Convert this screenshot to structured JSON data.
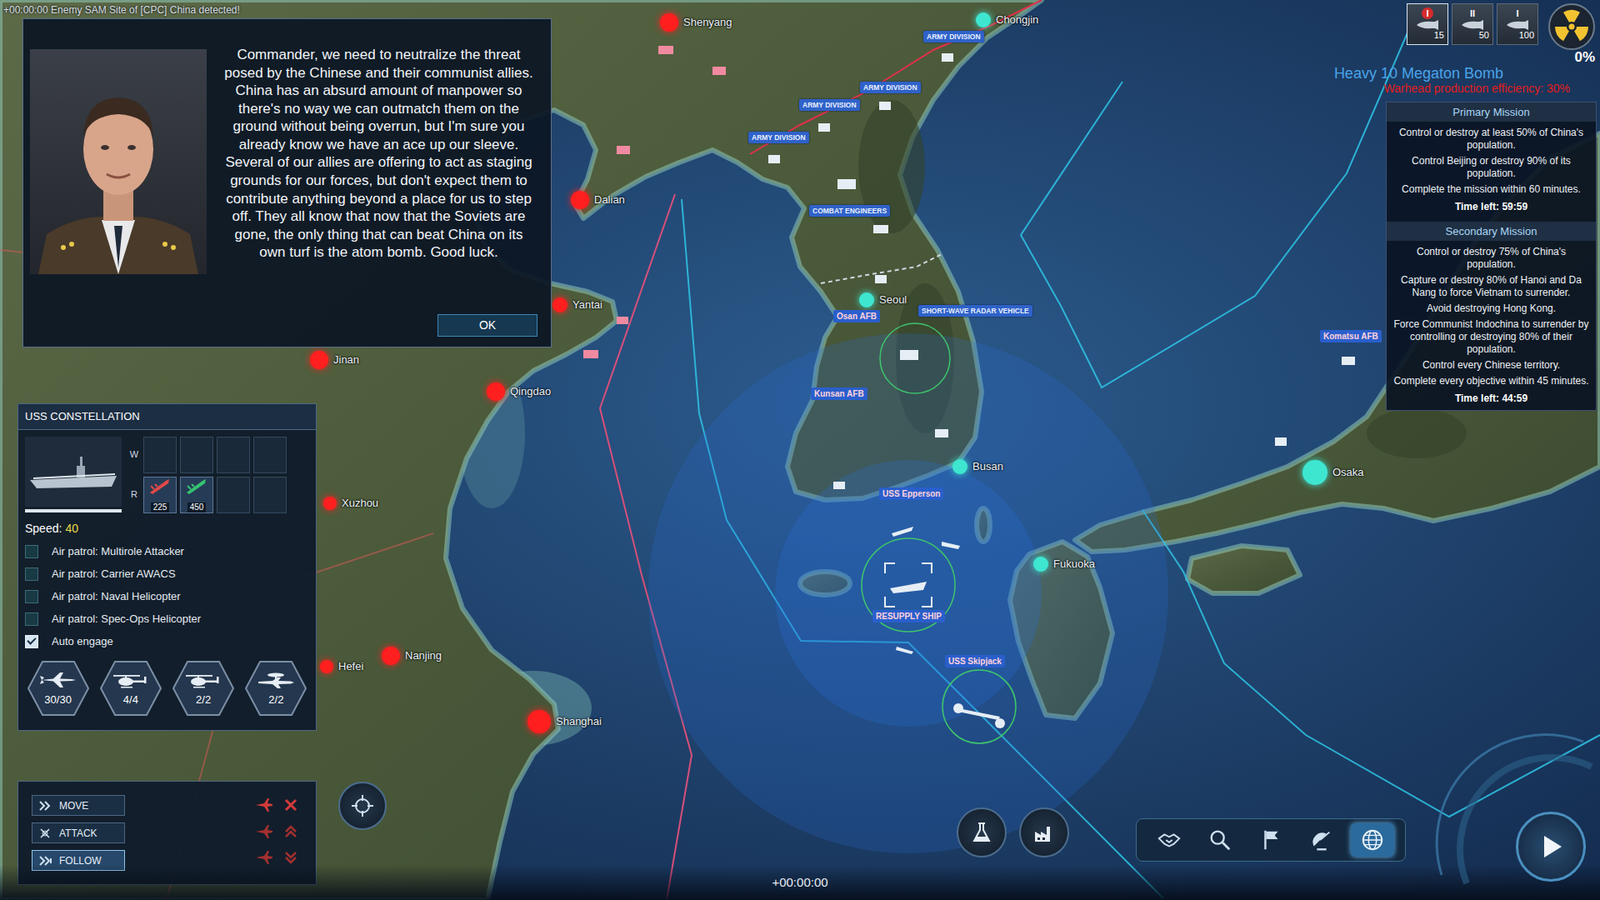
{
  "event_log": "+00:00:00 Enemy SAM Site of [CPC] China detected!",
  "dialog": {
    "message": "Commander, we need to neutralize the threat posed by the Chinese and their communist allies. China has an absurd amount of manpower so there's no way we can outmatch them on the ground without being overrun, but I'm sure you already know we have an ace up our sleeve. Several of our allies are offering to act as staging grounds for our forces, but don't expect them to contribute anything beyond a place for us to step off. They all know that now that the Soviets are gone, the only thing that can beat China on its own turf is the atom bomb. Good luck.",
    "button": "OK"
  },
  "map": {
    "cities": [
      {
        "name": "Shenyang",
        "color": "#ff1f1f"
      },
      {
        "name": "Chongjin",
        "color": "#3ee6d0"
      },
      {
        "name": "Dalian",
        "color": "#ff1f1f"
      },
      {
        "name": "Yantai",
        "color": "#ff1f1f"
      },
      {
        "name": "Jinan",
        "color": "#ff1f1f"
      },
      {
        "name": "Qingdao",
        "color": "#ff1f1f"
      },
      {
        "name": "Xuzhou",
        "color": "#ff1f1f"
      },
      {
        "name": "Hefei",
        "color": "#ff1f1f"
      },
      {
        "name": "Nanjing",
        "color": "#ff1f1f"
      },
      {
        "name": "Shanghai",
        "color": "#ff1f1f"
      },
      {
        "name": "Seoul",
        "color": "#3ee6d0"
      },
      {
        "name": "Busan",
        "color": "#3ee6d0"
      },
      {
        "name": "Fukuoka",
        "color": "#3ee6d0"
      },
      {
        "name": "Osaka",
        "color": "#3ee6d0"
      }
    ],
    "unit_tags": [
      "ARMY DIVISION",
      "ARMY DIVISION",
      "ARMY DIVISION",
      "ARMY DIVISION",
      "COMBAT ENGINEERS",
      "SHORT-WAVE RADAR VEHICLE"
    ],
    "named_units": [
      "Osan AFB",
      "Kunsan AFB",
      "USS Epperson",
      "RESUPPLY SHIP",
      "USS Skipjack",
      "Komatsu AFB"
    ]
  },
  "arsenal": {
    "slots": [
      {
        "tier": "I",
        "count": "15",
        "selected": true
      },
      {
        "tier": "II",
        "count": "50",
        "selected": false
      },
      {
        "tier": "I",
        "count": "100",
        "selected": false
      }
    ],
    "nuke_progress": "0%",
    "weapon_name": "Heavy 10 Megaton Bomb",
    "efficiency": "Warhead production efficiency: 30%"
  },
  "missions": [
    {
      "title": "Primary Mission",
      "objectives": [
        "Control or destroy at least 50% of China's population.",
        "Control Beijing or destroy 90% of its population.",
        "Complete the mission within 60 minutes."
      ],
      "time_left": "Time left: 59:59"
    },
    {
      "title": "Secondary Mission",
      "objectives": [
        "Control or destroy 75% of China's population.",
        "Capture or destroy 80% of Hanoi and Da Nang to force Vietnam to surrender.",
        "Avoid destroying Hong Kong.",
        "Force Communist Indochina to surrender by controlling or destroying 80% of their population.",
        "Control every Chinese territory.",
        "Complete every objective within 45 minutes."
      ],
      "time_left": "Time left: 44:59"
    }
  ],
  "unit": {
    "name": "USS CONSTELLATION",
    "health": {
      "level": 1
    },
    "slot_rows": [
      {
        "label": "W",
        "slots": [
          {
            "filled": false
          },
          {
            "filled": false
          },
          {
            "filled": false
          },
          {
            "filled": false
          }
        ]
      },
      {
        "label": "R",
        "slots": [
          {
            "filled": true,
            "count": "225",
            "color": "#e24848"
          },
          {
            "filled": true,
            "count": "450",
            "color": "#35c46f"
          },
          {
            "filled": false
          },
          {
            "filled": false
          }
        ]
      }
    ],
    "speed_label": "Speed:",
    "speed": "40",
    "patrols": [
      {
        "label": "Air patrol: Multirole Attacker",
        "checked": false
      },
      {
        "label": "Air patrol: Carrier AWACS",
        "checked": false
      },
      {
        "label": "Air patrol: Naval Helicopter",
        "checked": false
      },
      {
        "label": "Air patrol: Spec-Ops Helicopter",
        "checked": false
      },
      {
        "label": "Auto engage",
        "checked": true
      }
    ],
    "aircraft": [
      {
        "kind": "attacker",
        "count": "30/30"
      },
      {
        "kind": "helicopter",
        "count": "4/4"
      },
      {
        "kind": "helicopter",
        "count": "2/2"
      },
      {
        "kind": "awacs",
        "count": "2/2"
      }
    ]
  },
  "commands": [
    {
      "kind": "move",
      "label": "MOVE",
      "selected": false
    },
    {
      "kind": "attack",
      "label": "ATTACK",
      "selected": false
    },
    {
      "kind": "follow",
      "label": "FOLLOW",
      "selected": true
    }
  ],
  "clock": "+00:00:00",
  "toolbar": [
    {
      "kind": "diplomacy",
      "selected": false
    },
    {
      "kind": "intel",
      "selected": false
    },
    {
      "kind": "flag",
      "selected": false
    },
    {
      "kind": "radar",
      "selected": false
    },
    {
      "kind": "globe",
      "selected": true
    }
  ]
}
